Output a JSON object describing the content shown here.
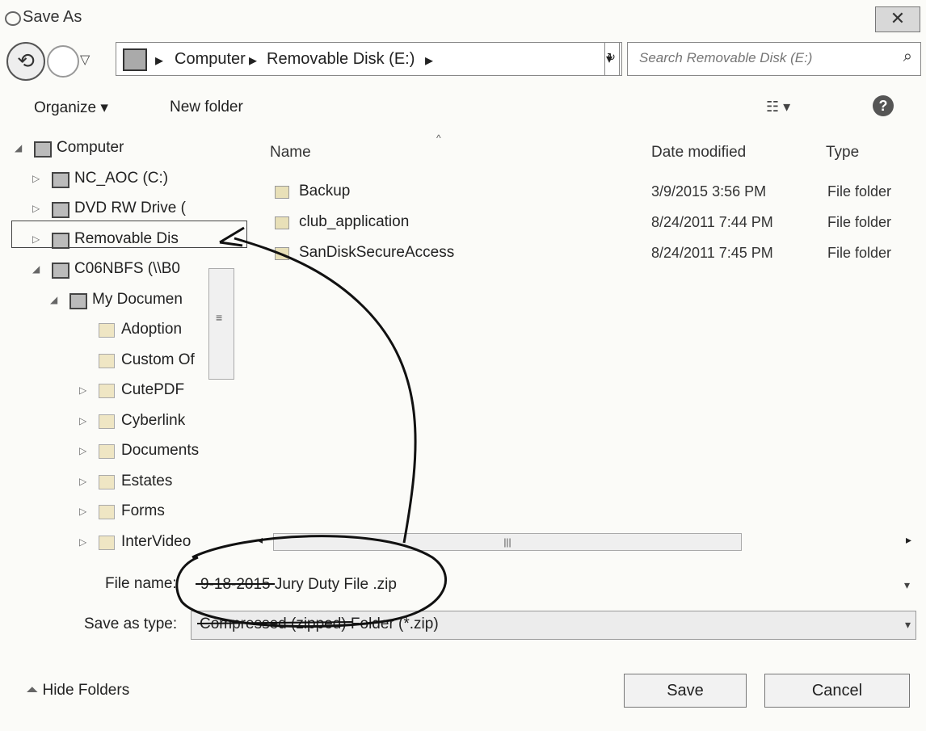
{
  "window": {
    "title": "Save As",
    "close_label": "✕"
  },
  "nav": {
    "back_glyph": "⟲",
    "address": [
      "Computer",
      "Removable Disk (E:)"
    ],
    "search_placeholder": "Search Removable Disk (E:)"
  },
  "toolbar": {
    "organize": "Organize ▾",
    "new_folder": "New folder",
    "help": "?"
  },
  "tree": [
    {
      "label": "Computer",
      "level": 0,
      "expanded": true
    },
    {
      "label": "NC_AOC (C:)",
      "level": 1
    },
    {
      "label": "DVD RW Drive (",
      "level": 1
    },
    {
      "label": "Removable Dis",
      "level": 1,
      "selected": true
    },
    {
      "label": "C06NBFS (\\\\B0",
      "level": 1,
      "expanded": true
    },
    {
      "label": "My Documen",
      "level": 2,
      "expanded": true
    },
    {
      "label": "Adoption",
      "level": 3
    },
    {
      "label": "Custom Of",
      "level": 3
    },
    {
      "label": "CutePDF",
      "level": 3
    },
    {
      "label": "Cyberlink",
      "level": 3
    },
    {
      "label": "Documents",
      "level": 3
    },
    {
      "label": "Estates",
      "level": 3
    },
    {
      "label": "Forms",
      "level": 3
    },
    {
      "label": "InterVideo",
      "level": 3
    }
  ],
  "columns": {
    "name": "Name",
    "date": "Date modified",
    "type": "Type"
  },
  "files": [
    {
      "name": "Backup",
      "date": "3/9/2015 3:56 PM",
      "type": "File folder"
    },
    {
      "name": "club_application",
      "date": "8/24/2011 7:44 PM",
      "type": "File folder"
    },
    {
      "name": "SanDiskSecureAccess",
      "date": "8/24/2011 7:45 PM",
      "type": "File folder"
    }
  ],
  "form": {
    "file_name_label": "File name:",
    "file_name_value": "9-18-2015 Jury Duty File .zip",
    "save_as_type_label": "Save as type:",
    "save_as_type_value": "Compressed (zipped) Folder (*.zip)"
  },
  "footer": {
    "hide_folders": "Hide Folders",
    "save": "Save",
    "cancel": "Cancel"
  }
}
